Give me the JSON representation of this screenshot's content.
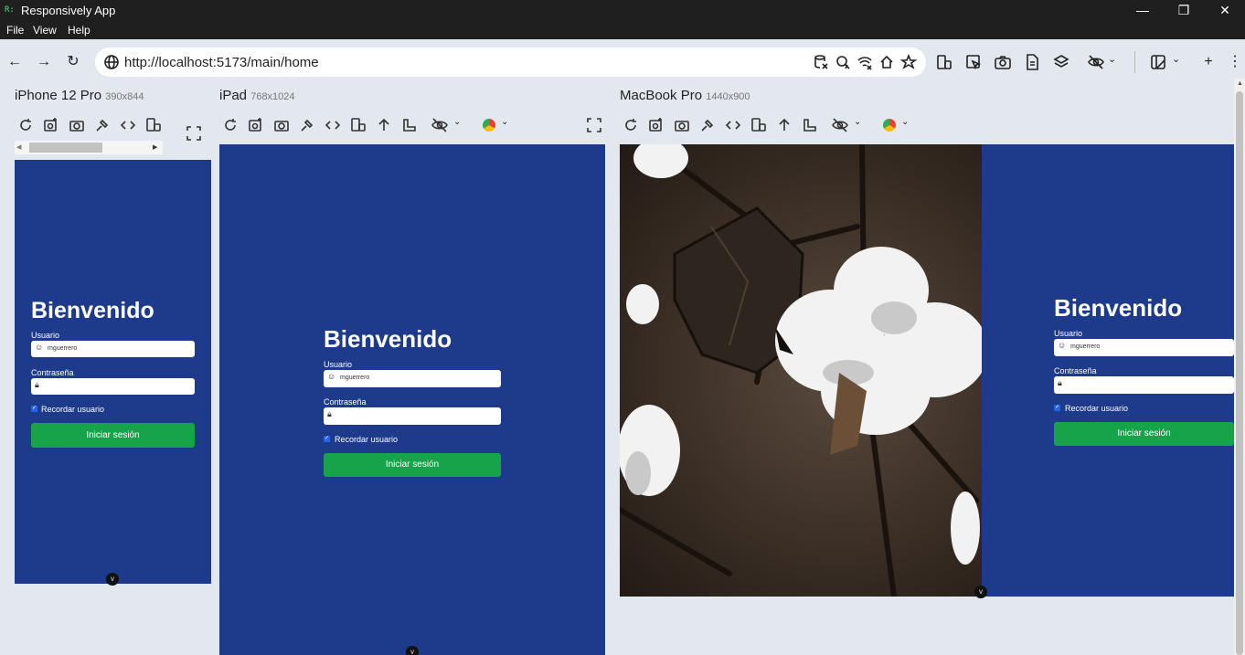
{
  "window": {
    "logo": "R:",
    "title": "Responsively App",
    "minimize": "—",
    "maximize": "❐",
    "close": "✕"
  },
  "menu": {
    "items": [
      "File",
      "View",
      "Help"
    ]
  },
  "nav": {
    "back": "←",
    "forward": "→",
    "reload": "↻",
    "url": "http://localhost:5173/main/home",
    "new_tab": "+",
    "more": "⋮"
  },
  "devices": [
    {
      "name": "iPhone 12 Pro",
      "size": "390x844"
    },
    {
      "name": "iPad",
      "size": "768x1024"
    },
    {
      "name": "MacBook Pro",
      "size": "1440x900"
    }
  ],
  "login": {
    "title": "Bienvenido",
    "user_label": "Usuario",
    "user_value": "mguerrero",
    "pass_label": "Contraseña",
    "remember_label": "Recordar usuario",
    "submit": "Iniciar sesión"
  },
  "colors": {
    "viewport_bg": "#1e3a8a",
    "button": "#16a34a",
    "titlebar": "#1f1f1f",
    "app_bg": "#e3e8ef"
  },
  "icons": {
    "scroll_down": "v"
  }
}
